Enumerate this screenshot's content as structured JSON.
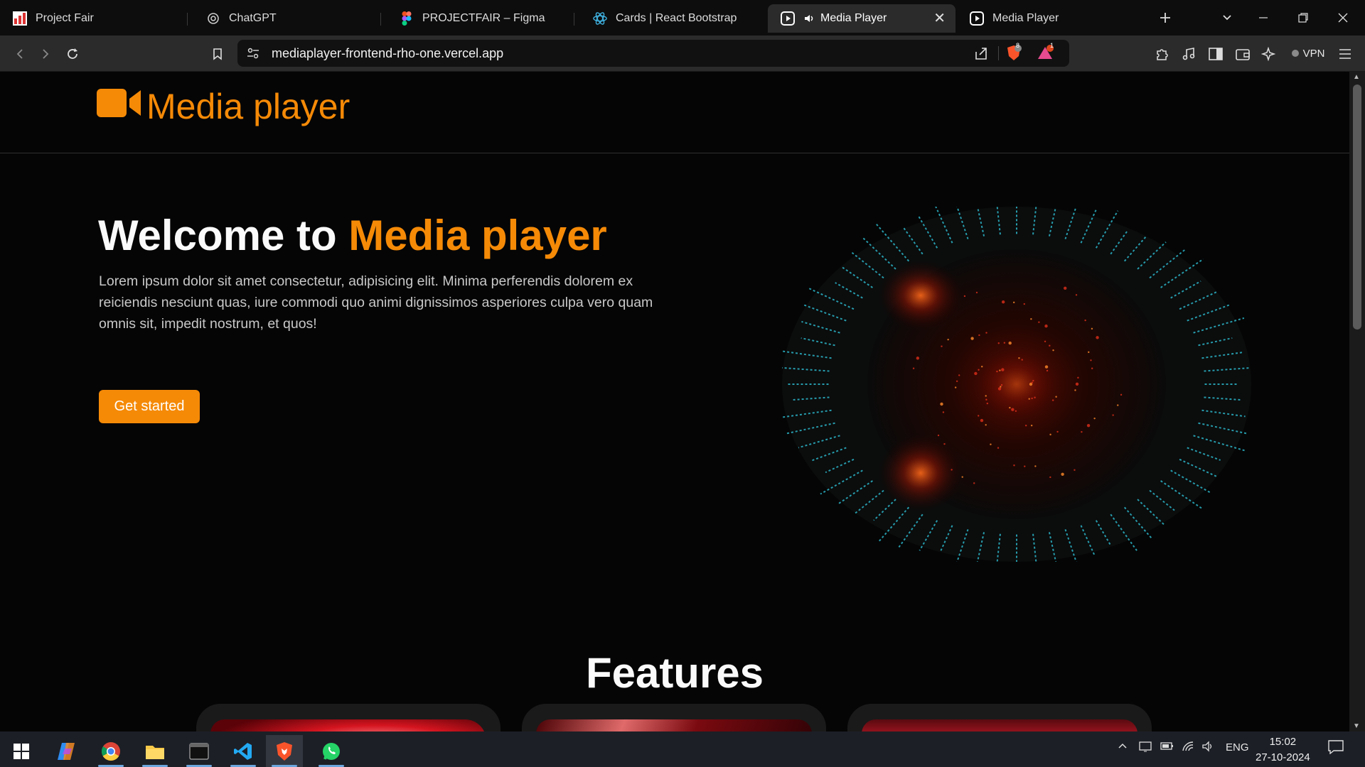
{
  "browser": {
    "tabs": [
      {
        "title": "Project Fair",
        "icon": "project-fair-favicon"
      },
      {
        "title": "ChatGPT",
        "icon": "chatgpt-favicon"
      },
      {
        "title": "PROJECTFAIR – Figma",
        "icon": "figma-favicon"
      },
      {
        "title": "Cards | React Bootstrap",
        "icon": "react-bootstrap-favicon"
      },
      {
        "title": "Media Player",
        "icon": "play-circle-favicon",
        "active": true,
        "audio": true
      },
      {
        "title": "Media Player",
        "icon": "play-circle-favicon"
      }
    ],
    "url": "mediaplayer-frontend-rho-one.vercel.app",
    "brave_shield_count": "8",
    "rewards_badge": "1",
    "vpn_label": "VPN"
  },
  "site": {
    "brand": "Media player",
    "hero": {
      "title_prefix": "Welcome to ",
      "title_accent": "Media player",
      "description": "Lorem ipsum dolor sit amet consectetur, adipisicing elit. Minima perferendis dolorem ex reiciendis nesciunt quas, iure commodi quo animi dignissimos asperiores culpa vero quam omnis sit, impedit nostrum, et quos!",
      "cta_label": "Get started"
    },
    "features_title": "Features"
  },
  "colors": {
    "accent": "#f58a07",
    "page_bg": "#050505"
  },
  "taskbar": {
    "apps": [
      "windows-start",
      "copilot",
      "chrome",
      "file-explorer",
      "terminal",
      "vscode",
      "brave",
      "whatsapp"
    ],
    "language": "ENG",
    "time": "15:02",
    "date": "27-10-2024"
  }
}
